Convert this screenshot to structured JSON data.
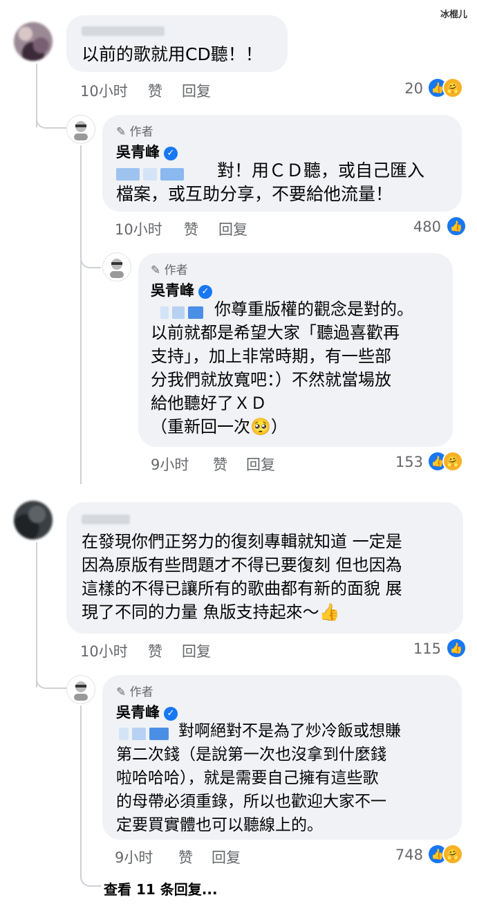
{
  "watermark": "冰棍儿",
  "labels": {
    "author_tag": "作者",
    "like": "赞",
    "reply": "回复"
  },
  "comments": [
    {
      "text": "以前的歌就用CD聽！！",
      "time": "10小时",
      "count": "20",
      "replies": [
        {
          "author": "吳青峰",
          "text": "對！用ＣＤ聽，或自己匯入\n檔案，或互助分享，不要給他流量！",
          "time": "10小时",
          "count": "480"
        },
        {
          "author": "吳青峰",
          "text": "你尊重版權的觀念是對的。\n以前就都是希望大家「聽過喜歡再\n支持」，加上非常時期，有一些部\n分我們就放寬吧：）不然就當場放\n給他聽好了ＸＤ\n（重新回一次🥺）",
          "time": "9小时",
          "count": "153"
        }
      ]
    },
    {
      "text": "在發現你們正努力的復刻專輯就知道 一定是\n因為原版有些問題才不得已要復刻 但也因為\n這樣的不得已讓所有的歌曲都有新的面貌 展\n現了不同的力量 魚版支持起來～👍",
      "time": "10小时",
      "count": "115",
      "replies": [
        {
          "author": "吳青峰",
          "text": "對啊絕對不是為了炒冷飯或想賺\n第二次錢（是說第一次也沒拿到什麼錢\n啦哈哈哈），就是需要自己擁有這些歌\n的母帶必須重錄，所以也歡迎大家不一\n定要買實體也可以聽線上的。",
          "time": "9小时",
          "count": "748"
        }
      ],
      "view_more": "查看 11 条回复..."
    }
  ],
  "icons": {
    "pen": "pen-icon",
    "verified": "verified-badge-icon",
    "like": "like-reaction-icon",
    "care": "care-reaction-icon"
  },
  "colors": {
    "bubble": "#f0f2f5",
    "meta": "#65676b",
    "accent": "#1877f2"
  }
}
